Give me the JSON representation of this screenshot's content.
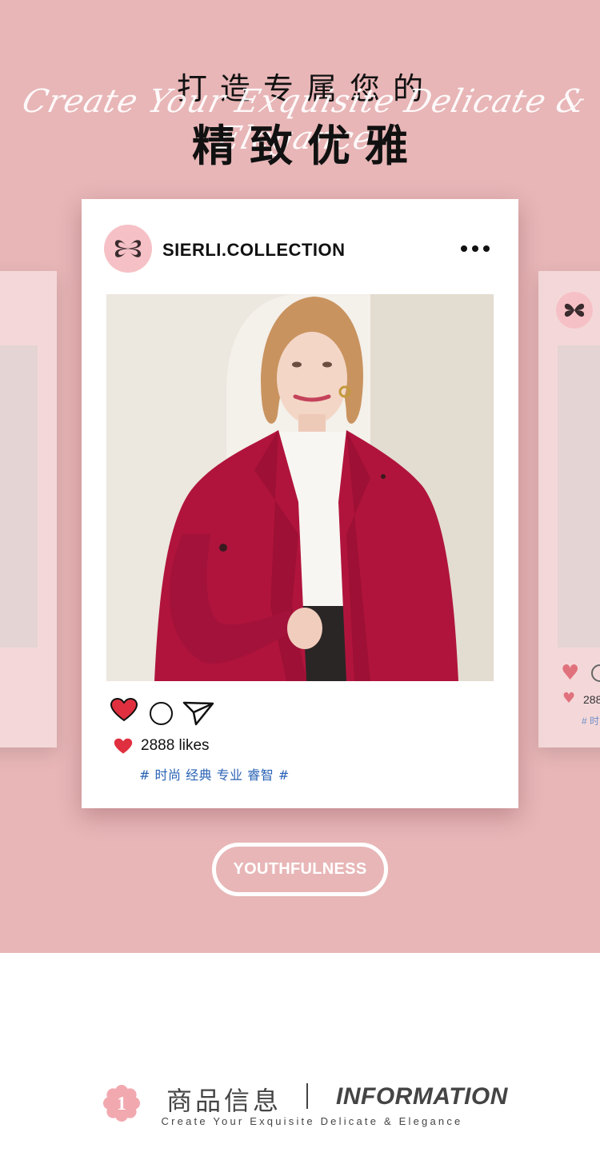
{
  "hero": {
    "headline_line1": "打造专属您的",
    "script_text": "Create Your Exquisite Delicate & Elegance",
    "headline_line2": "精致优雅",
    "background_color": "#e8b6b7"
  },
  "post": {
    "account_name": "SIERLI.COLLECTION",
    "avatar_icon": "butterfly-logo-icon",
    "more_icon": "more-dots-icon",
    "photo_alt": "Model wearing a red coat",
    "actions": [
      "heart-icon",
      "comment-icon",
      "send-icon"
    ],
    "likes_text": "2888 likes",
    "tags_text": "# 时尚 经典 专业 睿智 #",
    "heart_color": "#e0303f",
    "tag_color": "#2a62b5"
  },
  "side_post": {
    "likes_text": "288",
    "tags_text": "# 时"
  },
  "badge": {
    "label": "YOUTHFULNESS"
  },
  "info": {
    "number": "1",
    "title_cn": "商品信息",
    "title_en": "INFORMATION",
    "subtitle": "Create Your Exquisite Delicate & Elegance"
  }
}
